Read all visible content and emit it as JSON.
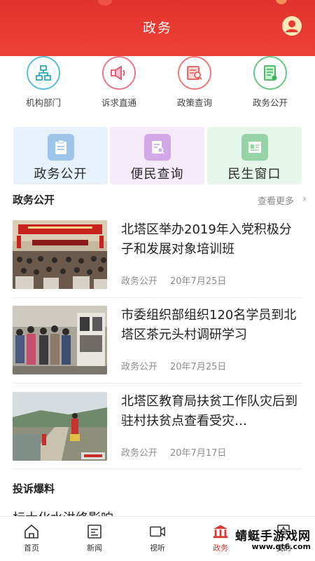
{
  "header": {
    "title": "政务"
  },
  "quick": [
    {
      "label": "机构部门",
      "icon": "org-chart-icon",
      "color": "#29a7c9"
    },
    {
      "label": "诉求直通",
      "icon": "megaphone-icon",
      "color": "#e8506a"
    },
    {
      "label": "政策查询",
      "icon": "policy-search-icon",
      "color": "#e85a5a"
    },
    {
      "label": "政务公开",
      "icon": "document-icon",
      "color": "#3fb25f"
    }
  ],
  "cards": [
    {
      "label": "政务公开",
      "icon": "clipboard-icon",
      "bg": "#e6f1fb",
      "accent": "#8fb8e4"
    },
    {
      "label": "便民查询",
      "icon": "doc-search-icon",
      "bg": "#f4eaf9",
      "accent": "#c99ae0"
    },
    {
      "label": "民生窗口",
      "icon": "id-card-icon",
      "bg": "#e6f6ea",
      "accent": "#8ed09e"
    }
  ],
  "section": {
    "title": "政务公开",
    "more": "查看更多"
  },
  "news": [
    {
      "title": "北塔区举办2019年入党积极分子和发展对象培训班",
      "source": "政务公开",
      "date": "20年7月25日",
      "image": "meeting-hall-photo"
    },
    {
      "title": "市委组织部组织120名学员到北塔区茶元头村调研学习",
      "source": "政务公开",
      "date": "20年7月25日",
      "image": "exhibition-visit-photo"
    },
    {
      "title": "北塔区教育局扶贫工作队灾后到驻村扶贫点查看受灾…",
      "source": "政务公开",
      "date": "20年7月17日",
      "image": "flooded-road-photo"
    }
  ],
  "complaint": {
    "title": "投诉爆料",
    "partial_text": "标大化水洪终影响"
  },
  "tabs": [
    {
      "label": "首页",
      "icon": "home-icon"
    },
    {
      "label": "新闻",
      "icon": "news-icon"
    },
    {
      "label": "视听",
      "icon": "video-icon"
    },
    {
      "label": "政务",
      "icon": "government-icon",
      "color": "#d93a30"
    },
    {
      "label": "我的",
      "icon": "profile-icon"
    }
  ],
  "watermark": {
    "name": "蜻蜓手游戏网",
    "url": "www.qt6.com"
  }
}
